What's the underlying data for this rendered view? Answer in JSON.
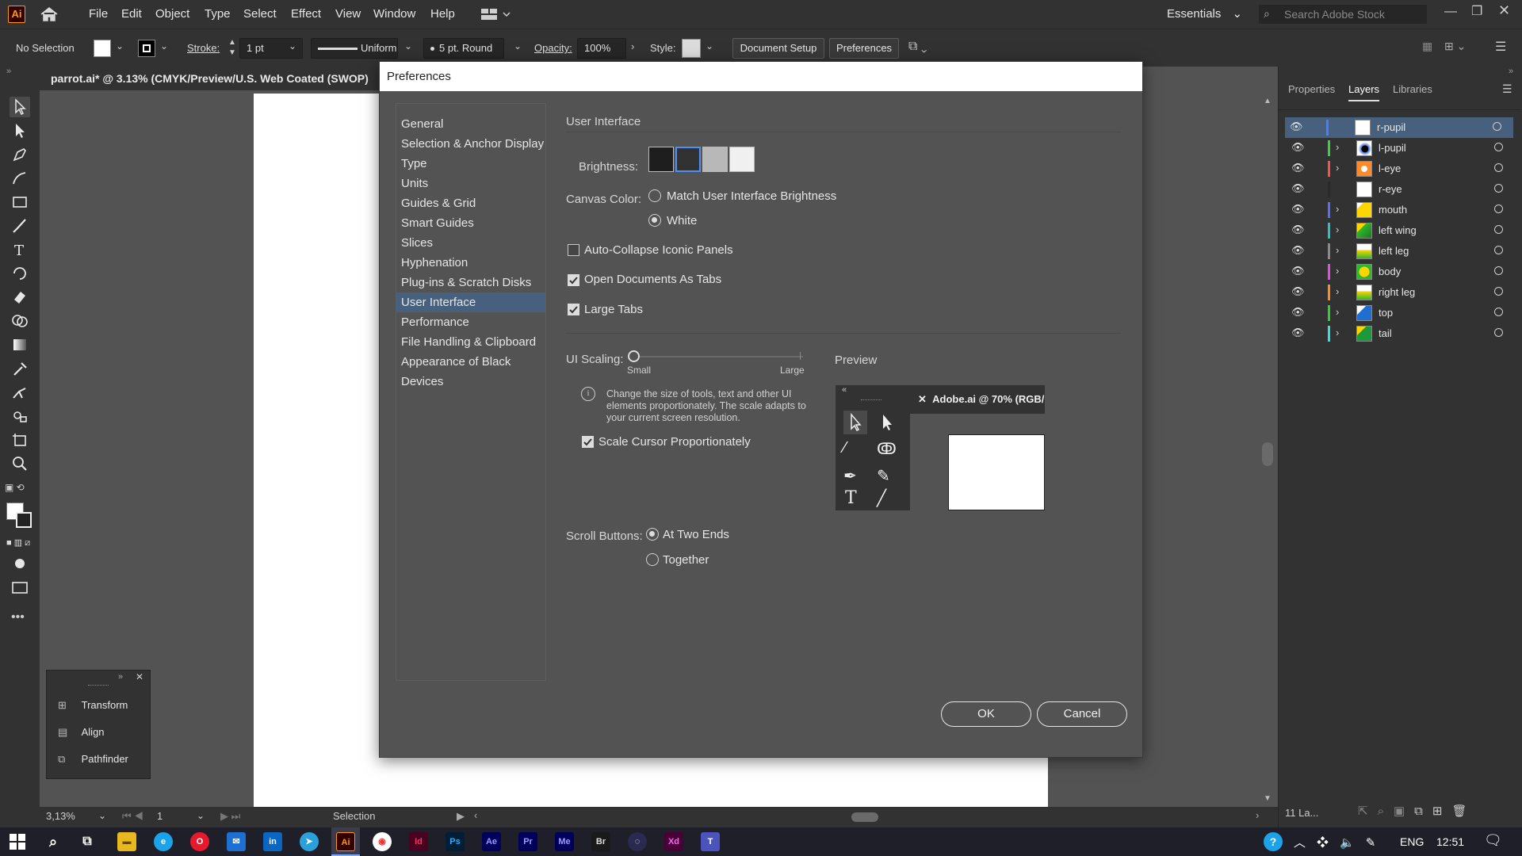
{
  "app": {
    "logo": "Ai",
    "menu": [
      "File",
      "Edit",
      "Object",
      "Type",
      "Select",
      "Effect",
      "View",
      "Window",
      "Help"
    ],
    "workspace": "Essentials",
    "search_placeholder": "Search Adobe Stock"
  },
  "control": {
    "selection": "No Selection",
    "stroke_label": "Stroke:",
    "stroke_value": "1 pt",
    "profile": "Uniform",
    "brush": "5 pt. Round",
    "opacity_label": "Opacity:",
    "opacity_value": "100%",
    "style_label": "Style:",
    "doc_setup": "Document Setup",
    "preferences": "Preferences"
  },
  "document": {
    "tab_title": "parrot.ai* @ 3.13% (CMYK/Preview/U.S. Web Coated (SWOP)",
    "zoom": "3,13%",
    "artboard": "1",
    "tool_status": "Selection"
  },
  "panels": {
    "tabs": [
      "Properties",
      "Layers",
      "Libraries"
    ],
    "active_tab": "Layers",
    "layer_count": "11 La..."
  },
  "layers": [
    {
      "name": "r-pupil",
      "color": "#4f7cff",
      "expand": false,
      "thumb": "white",
      "selected": true
    },
    {
      "name": "l-pupil",
      "color": "#3ed13e",
      "expand": true,
      "thumb": "pupil",
      "selected": false
    },
    {
      "name": "l-eye",
      "color": "#ff4f4f",
      "expand": true,
      "thumb": "eye",
      "selected": false
    },
    {
      "name": "r-eye",
      "color": "#2a2a2a",
      "expand": false,
      "thumb": "white",
      "selected": false
    },
    {
      "name": "mouth",
      "color": "#5a6bff",
      "expand": true,
      "thumb": "yellow",
      "selected": false
    },
    {
      "name": "left wing",
      "color": "#27c4c4",
      "expand": true,
      "thumb": "wing",
      "selected": false
    },
    {
      "name": "left leg",
      "color": "#8a8a8a",
      "expand": true,
      "thumb": "leg",
      "selected": false
    },
    {
      "name": "body",
      "color": "#e04fe0",
      "expand": true,
      "thumb": "body",
      "selected": false
    },
    {
      "name": "right leg",
      "color": "#ff8a27",
      "expand": true,
      "thumb": "leg",
      "selected": false
    },
    {
      "name": "top",
      "color": "#2ed12e",
      "expand": true,
      "thumb": "top",
      "selected": false
    },
    {
      "name": "tail",
      "color": "#3bdede",
      "expand": true,
      "thumb": "tail",
      "selected": false
    }
  ],
  "float_panel": {
    "items": [
      "Transform",
      "Align",
      "Pathfinder"
    ]
  },
  "dialog": {
    "title": "Preferences",
    "categories": [
      "General",
      "Selection & Anchor Display",
      "Type",
      "Units",
      "Guides & Grid",
      "Smart Guides",
      "Slices",
      "Hyphenation",
      "Plug-ins & Scratch Disks",
      "User Interface",
      "Performance",
      "File Handling & Clipboard",
      "Appearance of Black",
      "Devices"
    ],
    "selected_category": "User Interface",
    "section": "User Interface",
    "brightness_label": "Brightness:",
    "brightness_swatches": [
      "#1e1e1e",
      "#323232",
      "#b8b8b8",
      "#f0f0f0"
    ],
    "brightness_selected_index": 1,
    "canvas_color_label": "Canvas Color:",
    "canvas_options": [
      "Match User Interface Brightness",
      "White"
    ],
    "canvas_selected": "White",
    "auto_collapse": "Auto-Collapse Iconic Panels",
    "auto_collapse_checked": false,
    "open_as_tabs": "Open Documents As Tabs",
    "open_as_tabs_checked": true,
    "large_tabs": "Large Tabs",
    "large_tabs_checked": true,
    "ui_scaling_label": "UI Scaling:",
    "scale_small": "Small",
    "scale_large": "Large",
    "scaling_level": 0,
    "info_text": "Change the size of tools, text and other UI elements proportionately. The scale adapts to your current screen resolution.",
    "scale_cursor": "Scale Cursor Proportionately",
    "scale_cursor_checked": true,
    "preview_label": "Preview",
    "preview_doc": "Adobe.ai @ 70% (RGB/",
    "scroll_buttons_label": "Scroll Buttons:",
    "scroll_options": [
      "At Two Ends",
      "Together"
    ],
    "scroll_selected": "At Two Ends",
    "ok": "OK",
    "cancel": "Cancel"
  },
  "taskbar": {
    "language": "ENG",
    "time": "12:51"
  }
}
